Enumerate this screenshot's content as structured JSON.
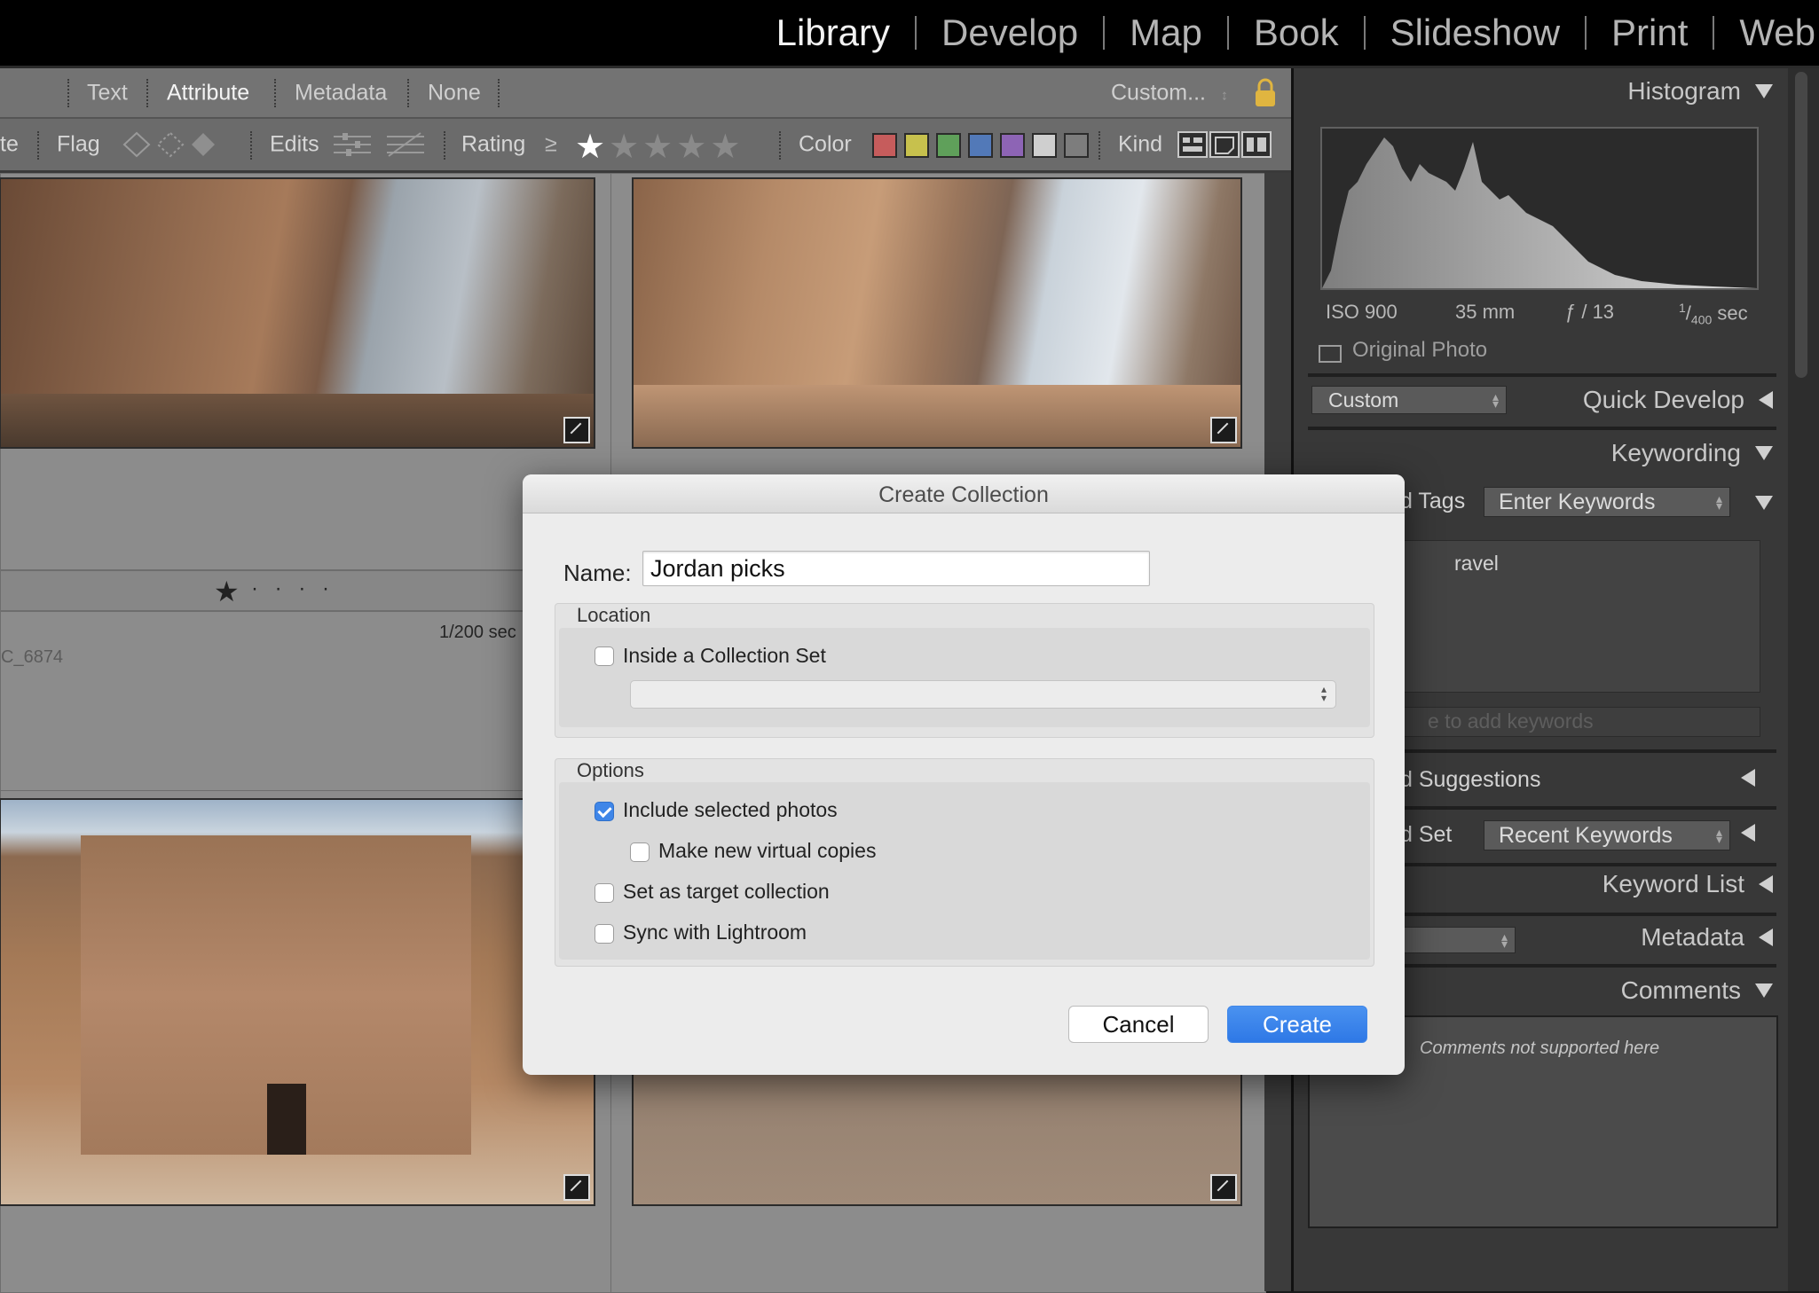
{
  "modules": {
    "items": [
      "Library",
      "Develop",
      "Map",
      "Book",
      "Slideshow",
      "Print",
      "Web"
    ],
    "active": "Library"
  },
  "filter_bar": {
    "tabs": [
      "Text",
      "Attribute",
      "Metadata",
      "None"
    ],
    "active_tab": "Attribute",
    "preset": "Custom...",
    "preset_arrow": "↕",
    "lock_icon": "lock-icon",
    "left_fragment": "te",
    "flag_label": "Flag",
    "edits_label": "Edits",
    "rating_label": "Rating",
    "rating_op": "≥",
    "rating_stars": 1,
    "color_label": "Color",
    "colors": [
      "#c65c5c",
      "#c7c14d",
      "#5fa05a",
      "#5279b8",
      "#8d64b5",
      "#cfcfcf",
      "#7d7d7d"
    ],
    "kind_label": "Kind"
  },
  "grid": {
    "cell_rating_stars": 1,
    "rating_dots": "·  ·  ·  ·",
    "shutter": "1/200 sec",
    "filename_fragment": "C_6874"
  },
  "right_panel": {
    "histogram": {
      "title": "Histogram",
      "iso": "ISO 900",
      "focal": "35 mm",
      "aperture": "ƒ / 13",
      "shutter_num": "1",
      "shutter_den": "400",
      "shutter_unit": "sec",
      "original_photo": "Original Photo"
    },
    "quick_develop": {
      "preset": "Custom",
      "title": "Quick Develop"
    },
    "keywording": {
      "title": "Keywording",
      "tags_label_fragment": "d Tags",
      "tags_dropdown": "Enter Keywords",
      "keyword_fragment": "ravel",
      "input_fragment": "e to add keywords",
      "suggestions_fragment": "d Suggestions",
      "set_label_fragment": "d Set",
      "set_dropdown": "Recent Keywords"
    },
    "keyword_list": "Keyword List",
    "metadata": "Metadata",
    "comments": {
      "title": "Comments",
      "message": "Comments not supported here"
    }
  },
  "dialog": {
    "title": "Create Collection",
    "name_label": "Name:",
    "name_value": "Jordan picks",
    "location": {
      "label": "Location",
      "inside_set_label": "Inside a Collection Set",
      "inside_set_checked": false,
      "set_select_value": ""
    },
    "options": {
      "label": "Options",
      "include_selected": {
        "label": "Include selected photos",
        "checked": true
      },
      "virtual_copies": {
        "label": "Make new virtual copies",
        "checked": false
      },
      "target_collection": {
        "label": "Set as target collection",
        "checked": false
      },
      "sync": {
        "label": "Sync with Lightroom",
        "checked": false
      }
    },
    "cancel_label": "Cancel",
    "create_label": "Create",
    "accent": "#3f86e8"
  }
}
